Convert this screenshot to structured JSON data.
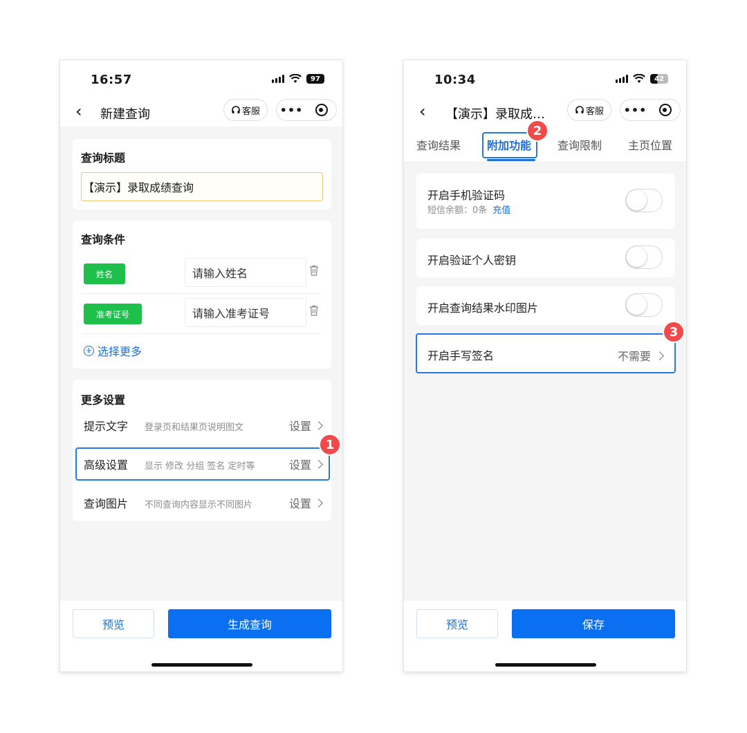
{
  "left": {
    "status": {
      "time": "16:57",
      "battery": "97"
    },
    "nav": {
      "title": "新建查询",
      "service": "客服"
    },
    "title_section": {
      "heading": "查询标题",
      "value": "【演示】录取成绩查询"
    },
    "conditions": {
      "heading": "查询条件",
      "items": [
        {
          "tag": "姓名",
          "placeholder": "请输入姓名"
        },
        {
          "tag": "准考证号",
          "placeholder": "请输入准考证号"
        }
      ],
      "select_more": "选择更多"
    },
    "more_settings": {
      "heading": "更多设置",
      "items": [
        {
          "label": "提示文字",
          "desc": "登录页和结果页说明图文",
          "action": "设置"
        },
        {
          "label": "高级设置",
          "desc": "显示 修改 分组 签名 定时等",
          "action": "设置"
        },
        {
          "label": "查询图片",
          "desc": "不同查询内容显示不同图片",
          "action": "设置"
        }
      ]
    },
    "badge": "1",
    "buttons": {
      "preview": "预览",
      "generate": "生成查询"
    }
  },
  "right": {
    "status": {
      "time": "10:34",
      "battery": "42"
    },
    "nav": {
      "title": "【演示】录取成…",
      "service": "客服"
    },
    "tabs": [
      "查询结果",
      "附加功能",
      "查询限制",
      "主页位置"
    ],
    "active_tab": "附加功能",
    "badge_tab": "2",
    "functions": [
      {
        "label": "开启手机验证码",
        "sub": "短信余额：0条",
        "sub_link": "充值",
        "enabled": false
      },
      {
        "label": "开启验证个人密钥",
        "enabled": false
      },
      {
        "label": "开启查询结果水印图片",
        "enabled": false
      },
      {
        "label": "开启手写签名",
        "value": "不需要"
      }
    ],
    "badge_signature": "3",
    "buttons": {
      "preview": "预览",
      "save": "保存"
    }
  },
  "colors": {
    "accent": "#1f6fd6",
    "primary_button": "#0a6ff0",
    "tag_green": "#1ebf4b",
    "badge_red": "#f2494a",
    "highlight": "#1f7ae6"
  },
  "icons": [
    "back-arrow-icon",
    "headset-icon",
    "more-dots-icon",
    "record-circle-icon",
    "signal-icon",
    "wifi-icon",
    "battery-icon",
    "trash-icon",
    "plus-circle-icon",
    "chevron-right-icon"
  ]
}
